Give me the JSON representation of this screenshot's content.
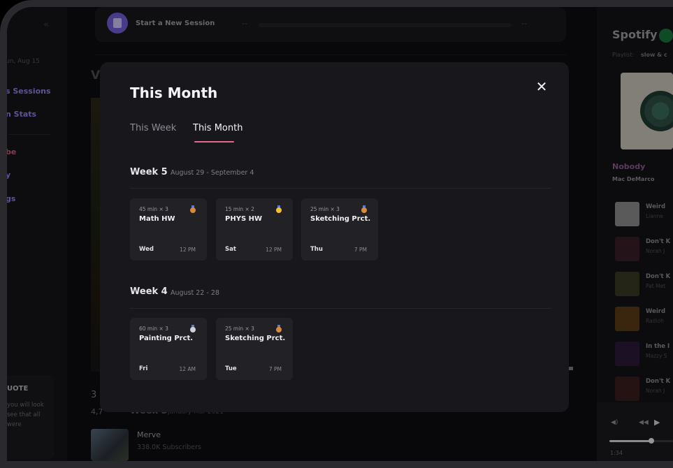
{
  "sidebar": {
    "date": "un, Aug 15",
    "nav": [
      {
        "label": "s Sessions",
        "color": "#8c82e6"
      },
      {
        "label": "n Stats",
        "color": "#8c82e6"
      },
      {
        "label": "be",
        "color": "#c0627e"
      },
      {
        "label": "y",
        "color": "#8c82e6"
      },
      {
        "label": "gs",
        "color": "#8c82e6"
      }
    ],
    "quote_title": "UOTE",
    "quote_text": "you will look see that all were"
  },
  "session_bar": {
    "label": "Start a New Session",
    "left_value": "--",
    "right_value": "--"
  },
  "background": {
    "heading_fragment": "V",
    "count_fragment": "3",
    "views_fragment": "4,7",
    "week3_label": "Week 3",
    "week3_range": "January-Mar 2021",
    "channel": {
      "name": "Merve",
      "subscribers": "338.0K Subscribers"
    }
  },
  "spotify": {
    "title": "Spotify",
    "playlist_label": "Playlist:",
    "playlist_name": "slow & c",
    "now_playing_track": "Nobody",
    "now_playing_artist": "Mac DeMarco",
    "songs": [
      {
        "title": "Weird",
        "artist": "Lianne",
        "thumb": "#8a8a8a"
      },
      {
        "title": "Don't K",
        "artist": "Norah J",
        "thumb": "#3a1e28"
      },
      {
        "title": "Don't K",
        "artist": "Pat Met",
        "thumb": "#3a3a24"
      },
      {
        "title": "Weird",
        "artist": "Radioh",
        "thumb": "#5a3a18"
      },
      {
        "title": "In the I",
        "artist": "Mazzy S",
        "thumb": "#2a1a38"
      },
      {
        "title": "Don't K",
        "artist": "Norah J",
        "thumb": "#3a1e20"
      }
    ],
    "player": {
      "time": "1:34",
      "progress": 0.66
    }
  },
  "modal": {
    "title": "This Month",
    "tabs": [
      {
        "label": "This Week",
        "active": false
      },
      {
        "label": "This Month",
        "active": true
      }
    ],
    "accent": "#e36a8a",
    "weeks": [
      {
        "label": "Week 5",
        "range": "August 29 - September 4",
        "sessions": [
          {
            "duration": "45 min × 3",
            "name": "Math HW",
            "day": "Wed",
            "time": "12 PM",
            "medal": "bronze"
          },
          {
            "duration": "15 min × 2",
            "name": "PHYS HW",
            "day": "Sat",
            "time": "12 PM",
            "medal": "gold"
          },
          {
            "duration": "25 min × 3",
            "name": "Sketching Prct.",
            "day": "Thu",
            "time": "7 PM",
            "medal": "bronze"
          }
        ]
      },
      {
        "label": "Week 4",
        "range": "August 22 - 28",
        "sessions": [
          {
            "duration": "60 min × 3",
            "name": "Painting Prct.",
            "day": "Fri",
            "time": "12 AM",
            "medal": "silver"
          },
          {
            "duration": "25 min × 3",
            "name": "Sketching Prct.",
            "day": "Tue",
            "time": "7 PM",
            "medal": "bronze"
          }
        ]
      }
    ]
  }
}
